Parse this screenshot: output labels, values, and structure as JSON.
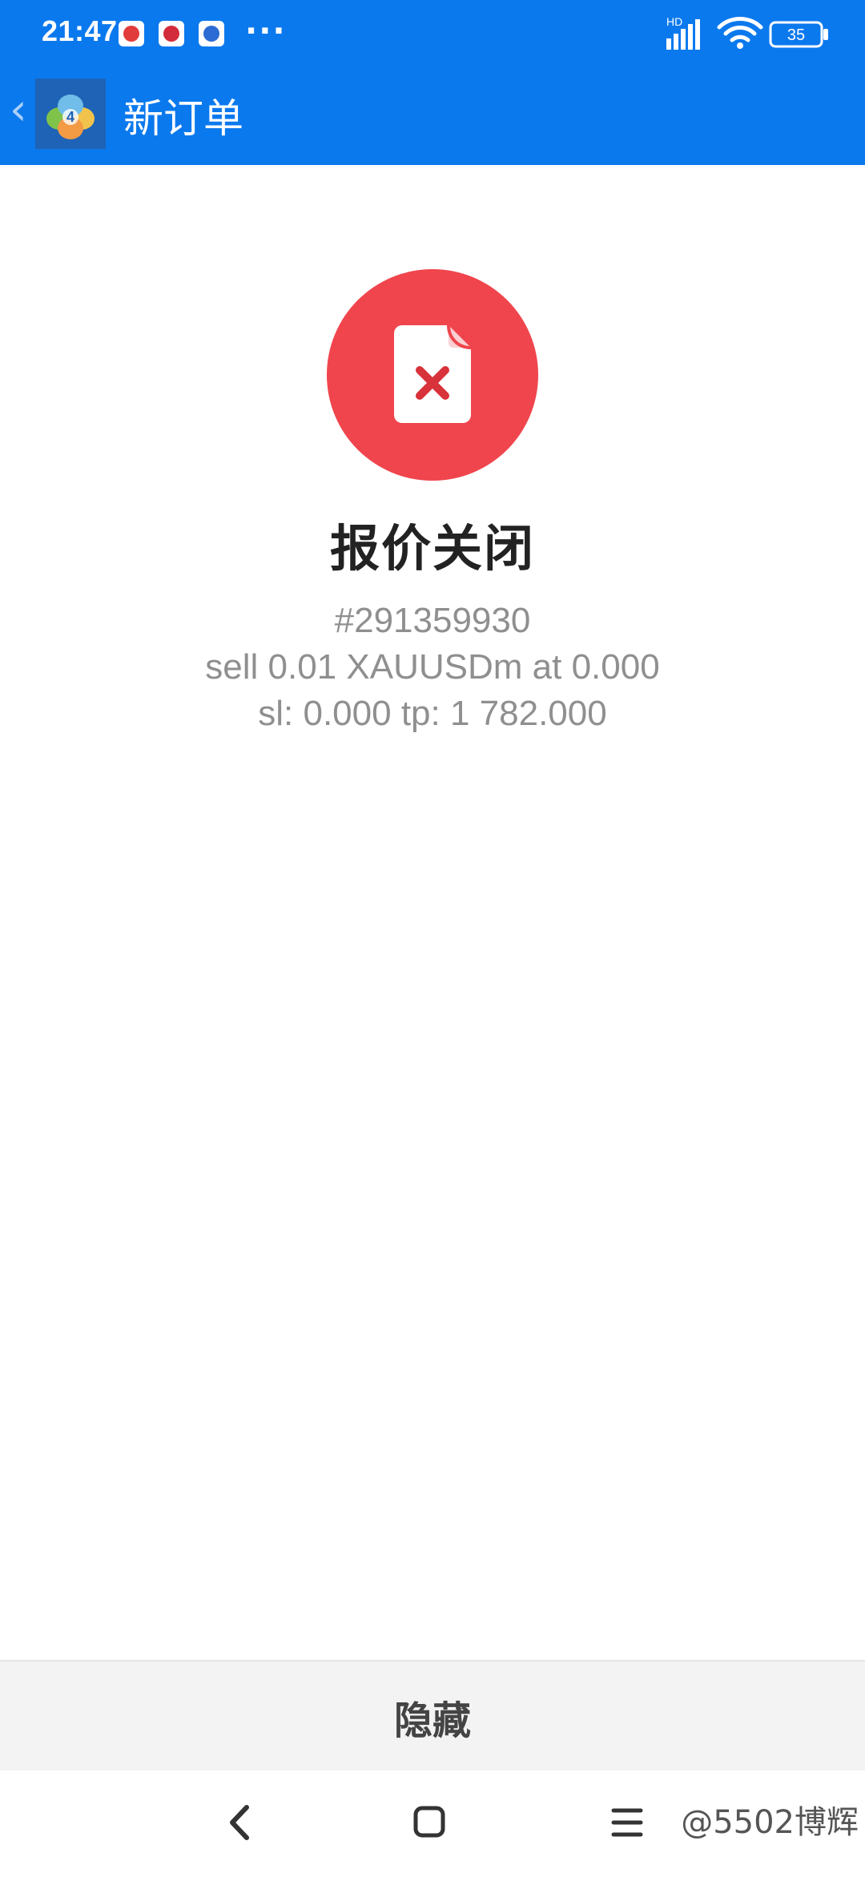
{
  "status_bar": {
    "time": "21:47",
    "more_indicator": "···",
    "signal_label": "HD",
    "battery_level": "35",
    "notification_icons": [
      "app-notification-icon",
      "app-notification-icon",
      "app-notification-icon"
    ]
  },
  "app_bar": {
    "back_glyph": "‹",
    "title": "新订单",
    "app_icon": "metatrader-icon"
  },
  "result": {
    "icon": "document-x-icon",
    "title": "报价关闭",
    "order_id": "#291359930",
    "order_line": "sell 0.01 XAUUSDm at 0.000",
    "sl_tp_line": "sl: 0.000 tp: 1 782.000"
  },
  "actions": {
    "hide_label": "隐藏"
  },
  "system_nav": {
    "back": "back-nav-icon",
    "home": "home-nav-icon",
    "recents": "recents-nav-icon"
  },
  "watermark": "@5502博辉",
  "colors": {
    "primary": "#0b79ee",
    "error": "#f0454d",
    "title_text": "#222222",
    "detail_text": "#8f8f8f",
    "bottom_bar": "#f3f3f3"
  }
}
